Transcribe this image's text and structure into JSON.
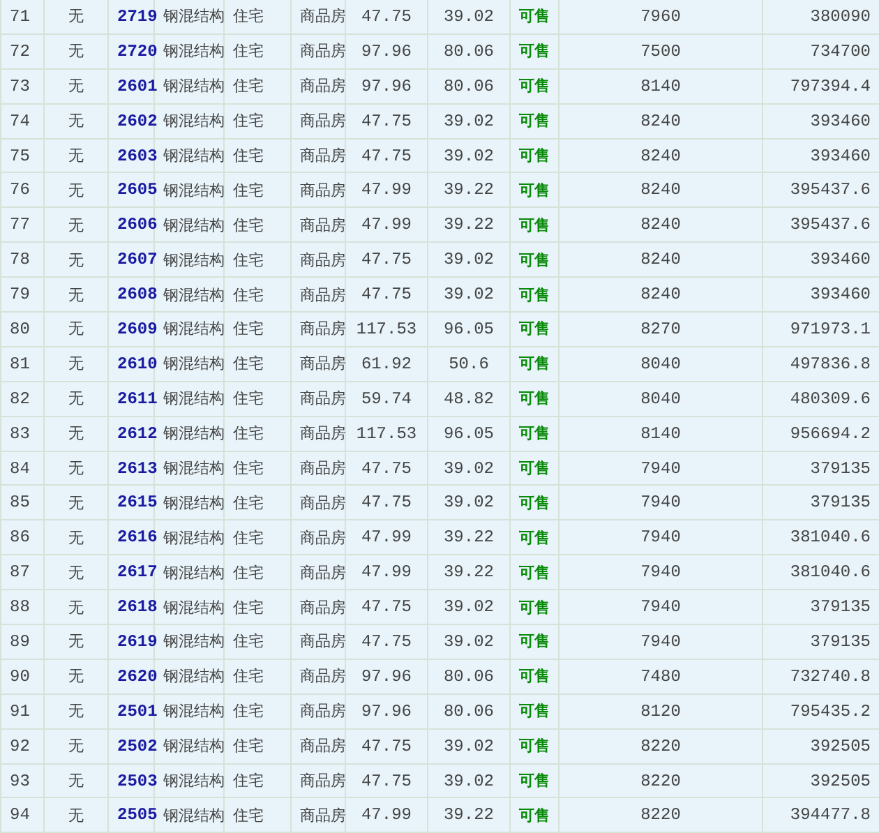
{
  "table": {
    "rows": [
      [
        "71",
        "无",
        "2719",
        "钢混结构",
        "住宅",
        "商品房",
        "47.75",
        "39.02",
        "可售",
        "7960",
        "380090"
      ],
      [
        "72",
        "无",
        "2720",
        "钢混结构",
        "住宅",
        "商品房",
        "97.96",
        "80.06",
        "可售",
        "7500",
        "734700"
      ],
      [
        "73",
        "无",
        "2601",
        "钢混结构",
        "住宅",
        "商品房",
        "97.96",
        "80.06",
        "可售",
        "8140",
        "797394.4"
      ],
      [
        "74",
        "无",
        "2602",
        "钢混结构",
        "住宅",
        "商品房",
        "47.75",
        "39.02",
        "可售",
        "8240",
        "393460"
      ],
      [
        "75",
        "无",
        "2603",
        "钢混结构",
        "住宅",
        "商品房",
        "47.75",
        "39.02",
        "可售",
        "8240",
        "393460"
      ],
      [
        "76",
        "无",
        "2605",
        "钢混结构",
        "住宅",
        "商品房",
        "47.99",
        "39.22",
        "可售",
        "8240",
        "395437.6"
      ],
      [
        "77",
        "无",
        "2606",
        "钢混结构",
        "住宅",
        "商品房",
        "47.99",
        "39.22",
        "可售",
        "8240",
        "395437.6"
      ],
      [
        "78",
        "无",
        "2607",
        "钢混结构",
        "住宅",
        "商品房",
        "47.75",
        "39.02",
        "可售",
        "8240",
        "393460"
      ],
      [
        "79",
        "无",
        "2608",
        "钢混结构",
        "住宅",
        "商品房",
        "47.75",
        "39.02",
        "可售",
        "8240",
        "393460"
      ],
      [
        "80",
        "无",
        "2609",
        "钢混结构",
        "住宅",
        "商品房",
        "117.53",
        "96.05",
        "可售",
        "8270",
        "971973.1"
      ],
      [
        "81",
        "无",
        "2610",
        "钢混结构",
        "住宅",
        "商品房",
        "61.92",
        "50.6",
        "可售",
        "8040",
        "497836.8"
      ],
      [
        "82",
        "无",
        "2611",
        "钢混结构",
        "住宅",
        "商品房",
        "59.74",
        "48.82",
        "可售",
        "8040",
        "480309.6"
      ],
      [
        "83",
        "无",
        "2612",
        "钢混结构",
        "住宅",
        "商品房",
        "117.53",
        "96.05",
        "可售",
        "8140",
        "956694.2"
      ],
      [
        "84",
        "无",
        "2613",
        "钢混结构",
        "住宅",
        "商品房",
        "47.75",
        "39.02",
        "可售",
        "7940",
        "379135"
      ],
      [
        "85",
        "无",
        "2615",
        "钢混结构",
        "住宅",
        "商品房",
        "47.75",
        "39.02",
        "可售",
        "7940",
        "379135"
      ],
      [
        "86",
        "无",
        "2616",
        "钢混结构",
        "住宅",
        "商品房",
        "47.99",
        "39.22",
        "可售",
        "7940",
        "381040.6"
      ],
      [
        "87",
        "无",
        "2617",
        "钢混结构",
        "住宅",
        "商品房",
        "47.99",
        "39.22",
        "可售",
        "7940",
        "381040.6"
      ],
      [
        "88",
        "无",
        "2618",
        "钢混结构",
        "住宅",
        "商品房",
        "47.75",
        "39.02",
        "可售",
        "7940",
        "379135"
      ],
      [
        "89",
        "无",
        "2619",
        "钢混结构",
        "住宅",
        "商品房",
        "47.75",
        "39.02",
        "可售",
        "7940",
        "379135"
      ],
      [
        "90",
        "无",
        "2620",
        "钢混结构",
        "住宅",
        "商品房",
        "97.96",
        "80.06",
        "可售",
        "7480",
        "732740.8"
      ],
      [
        "91",
        "无",
        "2501",
        "钢混结构",
        "住宅",
        "商品房",
        "97.96",
        "80.06",
        "可售",
        "8120",
        "795435.2"
      ],
      [
        "92",
        "无",
        "2502",
        "钢混结构",
        "住宅",
        "商品房",
        "47.75",
        "39.02",
        "可售",
        "8220",
        "392505"
      ],
      [
        "93",
        "无",
        "2503",
        "钢混结构",
        "住宅",
        "商品房",
        "47.75",
        "39.02",
        "可售",
        "8220",
        "392505"
      ],
      [
        "94",
        "无",
        "2505",
        "钢混结构",
        "住宅",
        "商品房",
        "47.99",
        "39.22",
        "可售",
        "8220",
        "394477.8"
      ]
    ]
  }
}
